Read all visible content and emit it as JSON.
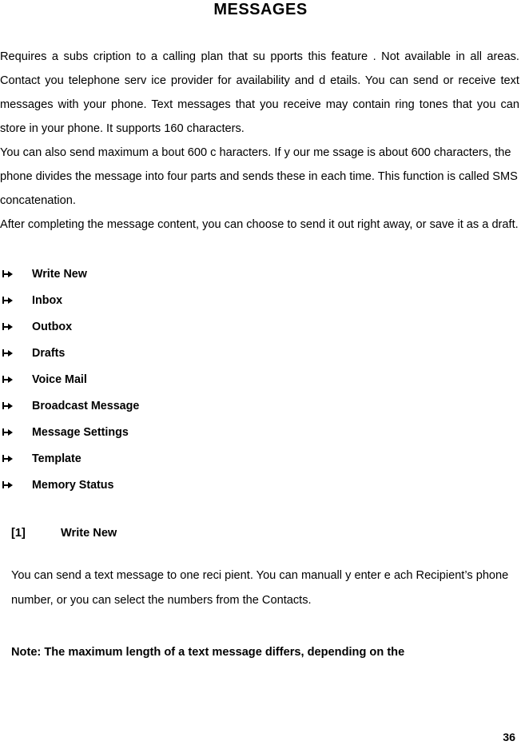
{
  "document": {
    "title": "MESSAGES",
    "intro_paragraphs": [
      "Requires a subs cription to a calling plan that su  pports this feature . Not available in all areas. Contact you telephone serv ice provider for  availability and d etails. You can send or receive text messages with your phone. Text messages that you receive may contain ring tones that you can store in your phone. It supports 160 characters.",
      "You can also send maximum a    bout 600 c haracters. If y  our me ssage is about 600 characters, the phone divides the message into four parts and sends these in each time. This function is called SMS concatenation.",
      "After completing the message content, you can choose to send it out right away, or save it as a draft."
    ],
    "menu_items": [
      {
        "label": "Write New",
        "icon": "arrow-bullet-icon"
      },
      {
        "label": "Inbox",
        "icon": "arrow-bullet-icon"
      },
      {
        "label": "Outbox",
        "icon": "arrow-bullet-icon"
      },
      {
        "label": "Drafts",
        "icon": "arrow-bullet-icon"
      },
      {
        "label": "Voice Mail",
        "icon": "arrow-bullet-icon"
      },
      {
        "label": "Broadcast Message",
        "icon": "arrow-bullet-icon"
      },
      {
        "label": "Message Settings",
        "icon": "arrow-bullet-icon"
      },
      {
        "label": "Template",
        "icon": "arrow-bullet-icon"
      },
      {
        "label": "Memory Status",
        "icon": "arrow-bullet-icon"
      }
    ],
    "section": {
      "number": "[1]",
      "title": "Write New",
      "body": "You can send a text message to one reci          pient.  You can manuall   y enter e   ach Recipient’s phone number, or you can select the numbers from the Contacts."
    },
    "note": "Note:  The  maximum  length  of  a  text  message  differs,  depending  on  the",
    "page_number": "36"
  }
}
